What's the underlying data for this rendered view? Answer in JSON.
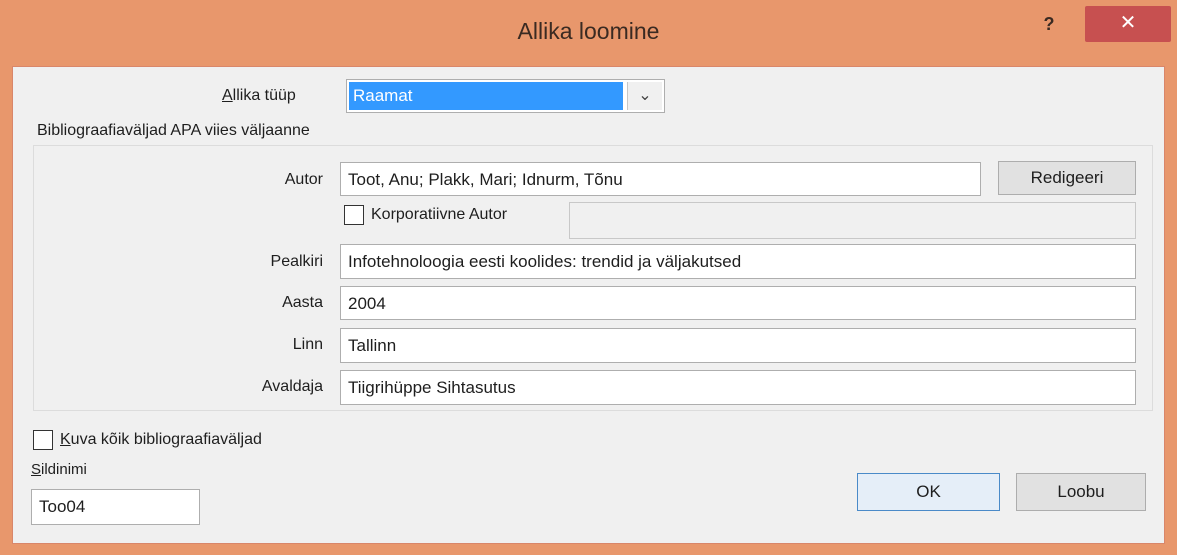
{
  "window": {
    "title": "Allika loomine",
    "help_label": "?",
    "close_label": "✕"
  },
  "source_type": {
    "label_underline": "A",
    "label_rest": "llika tüüp",
    "value": "Raamat"
  },
  "group": {
    "title": "Bibliograafiaväljad APA viies väljaanne"
  },
  "fields": {
    "author": {
      "label": "Autor",
      "value": "Toot, Anu; Plakk, Mari; Idnurm, Tõnu"
    },
    "edit_label": "Redigeeri",
    "corporate_label": "Korporatiivne Autor",
    "corporate_value": "",
    "title": {
      "label": "Pealkiri",
      "value": "Infotehnoloogia eesti koolides: trendid ja väljakutsed"
    },
    "year": {
      "label": "Aasta",
      "value": "2004"
    },
    "city": {
      "label": "Linn",
      "value": "Tallinn"
    },
    "publisher": {
      "label": "Avaldaja",
      "value": "Tiigrihüppe Sihtasutus"
    }
  },
  "show_all": {
    "label_underline": "K",
    "label_rest": "uva kõik bibliograafiaväljad"
  },
  "tag": {
    "label_underline": "S",
    "label_rest": "ildinimi",
    "value": "Too04"
  },
  "buttons": {
    "ok": "OK",
    "cancel": "Loobu"
  },
  "colors": {
    "title_bar": "#e8976c",
    "close": "#c75050",
    "selection": "#3399ff"
  }
}
